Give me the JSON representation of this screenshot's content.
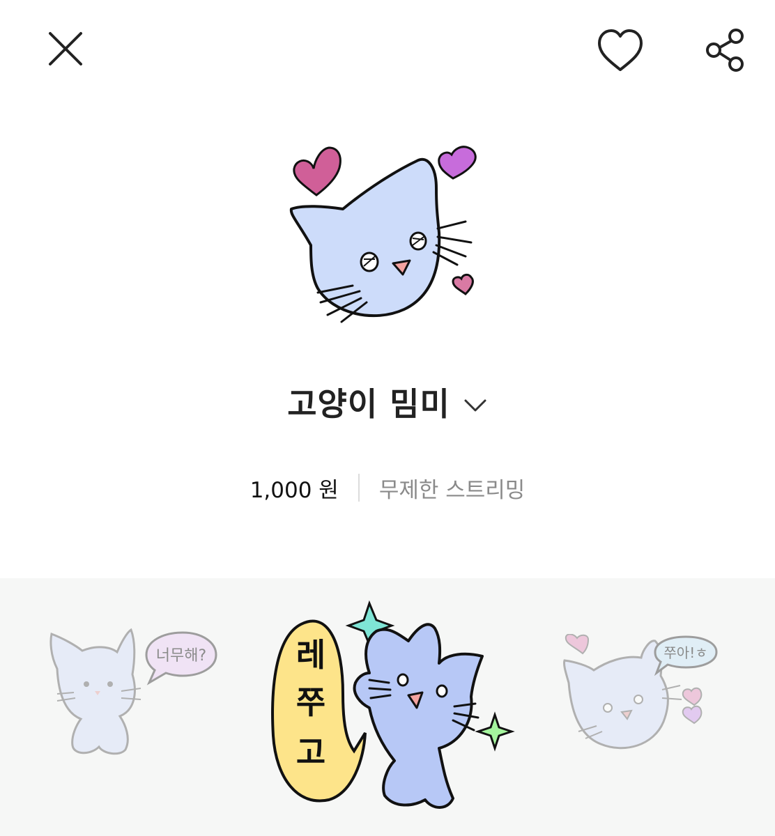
{
  "header": {
    "close_icon": "close-icon",
    "like_icon": "heart-outline-icon",
    "share_icon": "share-icon"
  },
  "product": {
    "title": "고양이 밈미",
    "price": "1,000 원",
    "streaming_label": "무제한 스트리밍",
    "expand_icon": "chevron-down-icon"
  },
  "previews": [
    {
      "bubble_text": "너무해?"
    },
    {
      "bubble_text": "레쭈고"
    },
    {
      "bubble_text": "쭈아!ㅎ"
    }
  ],
  "colors": {
    "cat_fill": "#cddcfa",
    "heart_pink": "#d05f98",
    "heart_purple": "#c76cdb",
    "bubble_yellow": "#fde48a",
    "star_teal": "#7fe5d6",
    "star_green": "#a5f59e",
    "strip_bg": "#f6f7f6"
  }
}
